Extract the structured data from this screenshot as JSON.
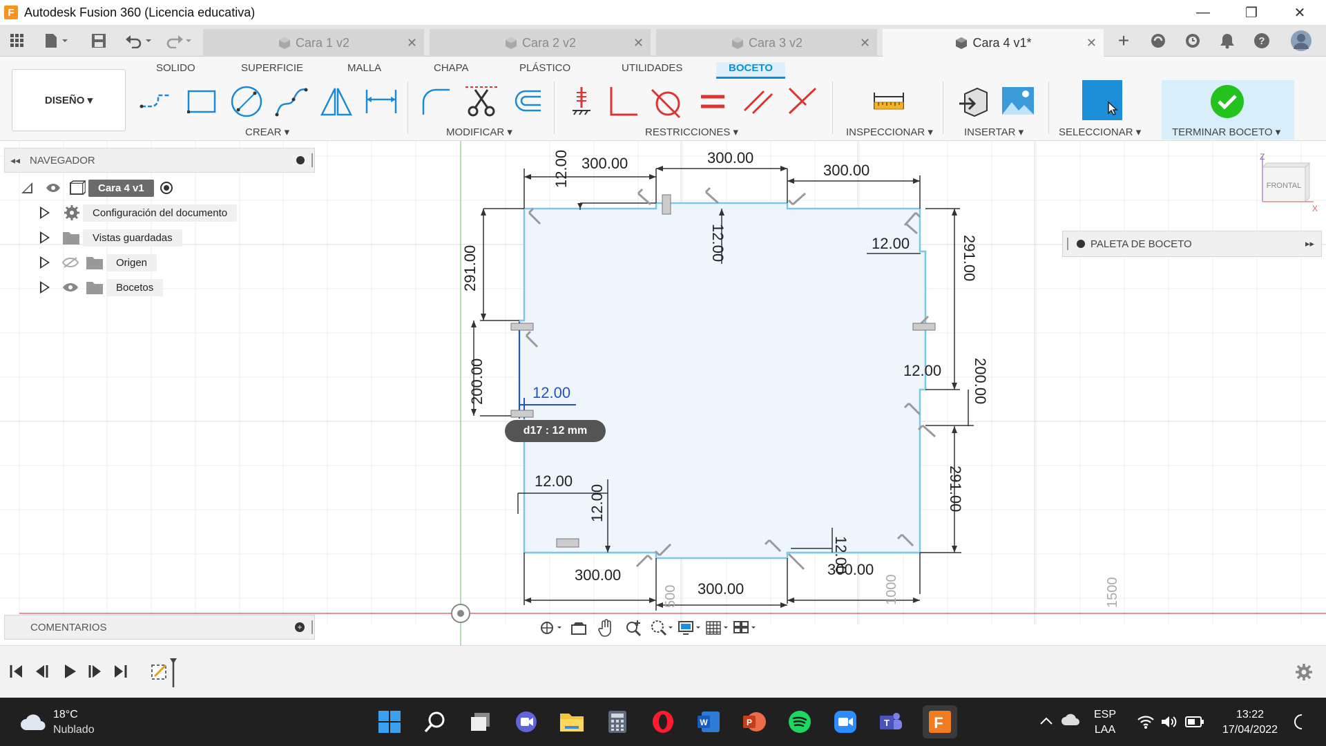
{
  "window": {
    "title": "Autodesk Fusion 360 (Licencia educativa)",
    "app_icon_letter": "F"
  },
  "tabs": [
    {
      "label": "Cara 1 v2",
      "active": false
    },
    {
      "label": "Cara 2 v2",
      "active": false
    },
    {
      "label": "Cara 3 v2",
      "active": false
    },
    {
      "label": "Cara 4 v1*",
      "active": true
    }
  ],
  "toolbar": {
    "workspace_tabs": [
      "SOLIDO",
      "SUPERFICIE",
      "MALLA",
      "CHAPA",
      "PLÁSTICO",
      "UTILIDADES",
      "BOCETO"
    ],
    "active_tab": "BOCETO",
    "design_label": "DISEÑO ▾",
    "groups": {
      "crear": "CREAR ▾",
      "modificar": "MODIFICAR ▾",
      "restricciones": "RESTRICCIONES ▾",
      "inspeccionar": "INSPECCIONAR ▾",
      "insertar": "INSERTAR ▾",
      "seleccionar": "SELECCIONAR ▾",
      "terminar": "TERMINAR BOCETO ▾"
    }
  },
  "navigator": {
    "title": "NAVEGADOR",
    "root": "Cara 4 v1",
    "items": [
      "Configuración del documento",
      "Vistas guardadas",
      "Origen",
      "Bocetos"
    ]
  },
  "palette": {
    "title": "PALETA DE BOCETO"
  },
  "comments": {
    "title": "COMENTARIOS"
  },
  "viewcube": {
    "label": "FRONTAL",
    "axis_z": "Z",
    "axis_x": "X"
  },
  "sketch": {
    "dimensions": [
      "300.00",
      "300.00",
      "300.00",
      "12.00",
      "12.00",
      "12.00",
      "291.00",
      "291.00",
      "200.00",
      "200.00",
      "12.00",
      "12.00",
      "12.00",
      "12.00",
      "12.00",
      "291.00",
      "300.00",
      "300.00",
      "300.00",
      "12.00"
    ],
    "active_dimension": "12.00",
    "tooltip": "d17 : 12 mm",
    "ruler": [
      "500",
      "1000",
      "1500"
    ]
  },
  "taskbar": {
    "temperature": "18°C",
    "weather": "Nublado",
    "lang_top": "ESP",
    "lang_bottom": "LAA",
    "time": "13:22",
    "date": "17/04/2022"
  },
  "colors": {
    "accent": "#0a8fd9",
    "sketch_line": "#7ec5ea",
    "sketch_fill": "#eef6fc",
    "finish_green": "#20c020"
  }
}
